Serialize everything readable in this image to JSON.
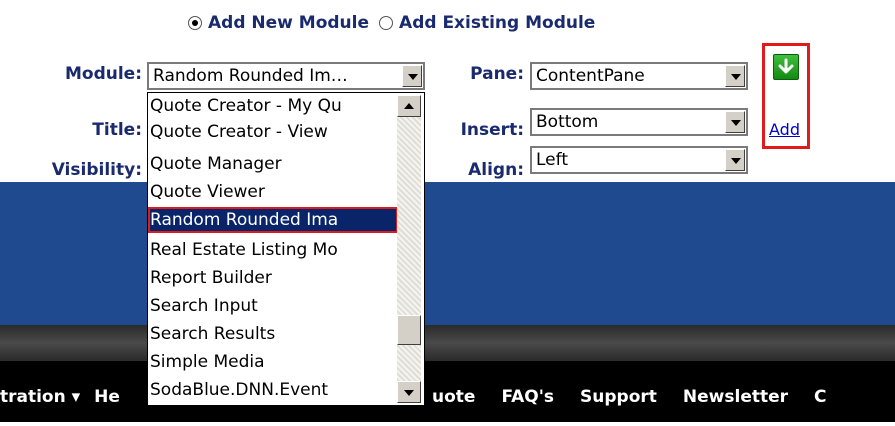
{
  "radio": {
    "add_new": "Add New Module",
    "add_existing": "Add Existing Module",
    "selected": "add_new"
  },
  "labels": {
    "module": "Module:",
    "title": "Title:",
    "visibility": "Visibility:",
    "pane": "Pane:",
    "insert": "Insert:",
    "align": "Align:"
  },
  "module_select": {
    "value": "Random Rounded Im…",
    "options": [
      "Quote Creator - My Qu",
      "Quote Creator - View",
      "Quote Manager",
      "Quote Viewer",
      "Random Rounded Ima",
      "Real Estate Listing Mo",
      "Report Builder",
      "Search Input",
      "Search Results",
      "Simple Media",
      "SodaBlue.DNN.Event"
    ],
    "highlighted": "Random Rounded Ima"
  },
  "pane_select": {
    "value": "ContentPane"
  },
  "insert_select": {
    "value": "Bottom"
  },
  "align_select": {
    "value": "Left"
  },
  "add_link": "Add",
  "nav": {
    "items": [
      "tration ▾",
      "He",
      "",
      "uote",
      "FAQ's",
      "Support",
      "Newsletter",
      "C"
    ]
  },
  "colors": {
    "label": "#1a2a6e",
    "band": "#1f4a8f",
    "highlight": "#0a246a",
    "red_outline": "#e01b1b"
  }
}
